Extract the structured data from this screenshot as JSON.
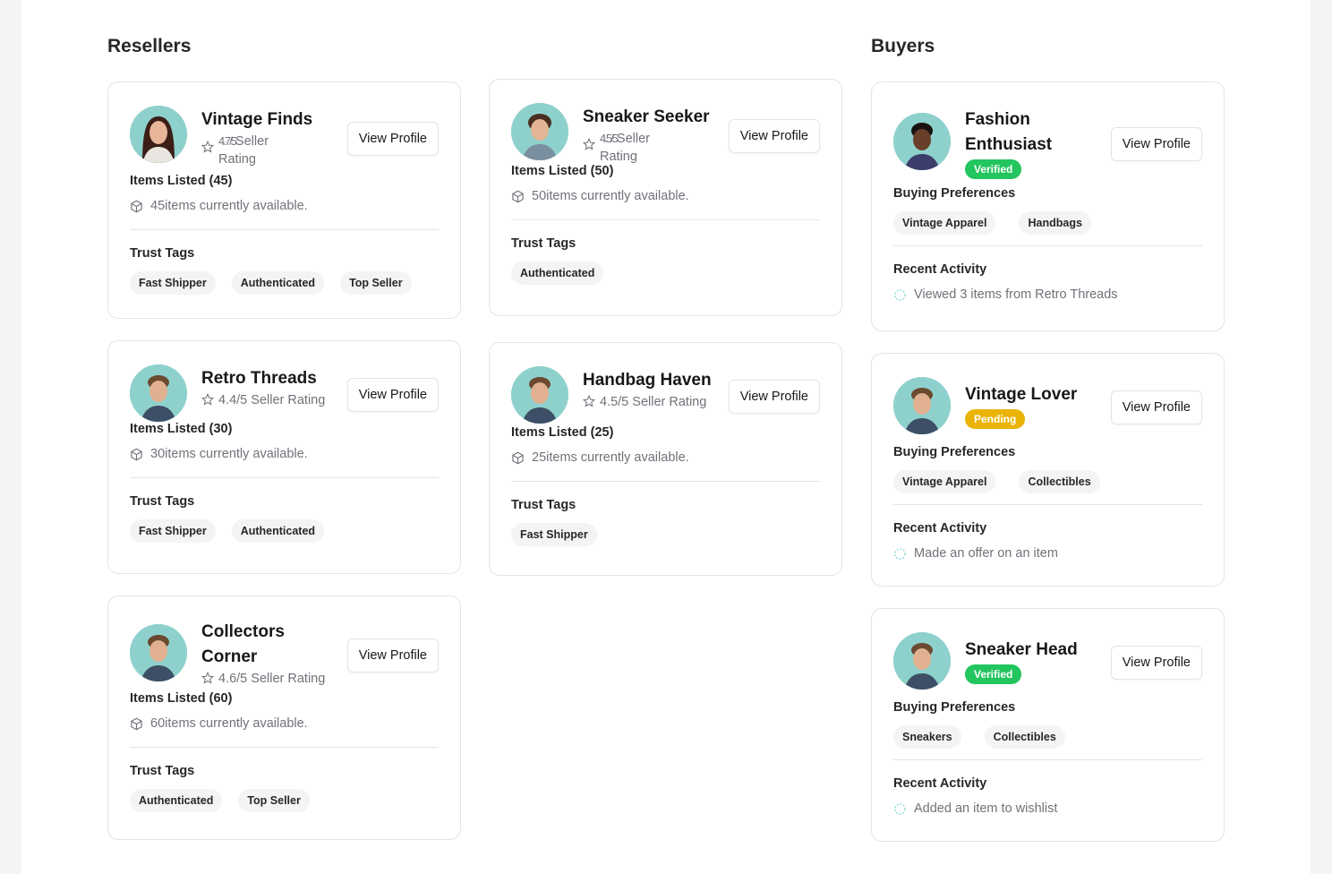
{
  "sections": {
    "resellers": "Resellers",
    "buyers": "Buyers"
  },
  "labels": {
    "view_profile": "View Profile",
    "trust_tags": "Trust Tags",
    "buying_preferences": "Buying Preferences",
    "recent_activity": "Recent Activity"
  },
  "resellers": [
    {
      "name": "Vintage Finds",
      "rating_top": "4.7/5",
      "rating_rest": "Seller",
      "rating_line2": "Rating",
      "items_listed": "Items Listed (45)",
      "available": "45items currently available.",
      "tags": [
        "Fast Shipper",
        "Authenticated",
        "Top Seller"
      ]
    },
    {
      "name": "Sneaker Seeker",
      "rating_top": "4.5/5",
      "rating_rest": "Seller",
      "rating_line2": "Rating",
      "items_listed": "Items Listed (50)",
      "available": "50items currently available.",
      "tags": [
        "Authenticated"
      ]
    },
    {
      "name": "Retro Threads",
      "rating": "4.4/5 Seller Rating",
      "items_listed": "Items Listed (30)",
      "available": "30items currently available.",
      "tags": [
        "Fast Shipper",
        "Authenticated"
      ]
    },
    {
      "name": "Handbag Haven",
      "rating": "4.5/5 Seller Rating",
      "items_listed": "Items Listed (25)",
      "available": "25items currently available.",
      "tags": [
        "Fast Shipper"
      ]
    },
    {
      "name_line1": "Collectors",
      "name_line2": "Corner",
      "rating": "4.6/5 Seller Rating",
      "items_listed": "Items Listed (60)",
      "available": "60items currently available.",
      "tags": [
        "Authenticated",
        "Top Seller"
      ]
    }
  ],
  "buyers": [
    {
      "name_line1": "Fashion",
      "name_line2": "Enthusiast",
      "status": "Verified",
      "preferences": [
        "Vintage Apparel",
        "Handbags"
      ],
      "activity": "Viewed 3 items from Retro Threads"
    },
    {
      "name": "Vintage Lover",
      "status": "Pending",
      "preferences": [
        "Vintage Apparel",
        "Collectibles"
      ],
      "activity": "Made an offer on an item"
    },
    {
      "name": "Sneaker Head",
      "status": "Verified",
      "preferences": [
        "Sneakers",
        "Collectibles"
      ],
      "activity": "Added an item to wishlist"
    }
  ],
  "colors": {
    "verified": "#22c55e",
    "pending": "#eab308",
    "avatar_bg": "#8ed1cc"
  },
  "icons": {
    "rating": "star-icon",
    "items": "package-icon",
    "activity": "activity-dots-icon"
  }
}
